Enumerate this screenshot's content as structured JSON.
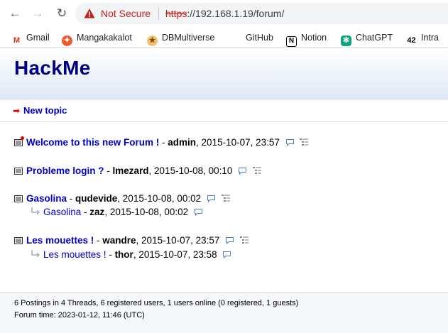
{
  "browser": {
    "not_secure": "Not Secure",
    "url_proto": "https",
    "url_rest": "://192.168.1.19/forum/"
  },
  "bookmarks": [
    {
      "label": "Gmail",
      "icon": "gmail-icon"
    },
    {
      "label": "Mangakakalot",
      "icon": "mangakakalot-icon"
    },
    {
      "label": "DBMultiverse",
      "icon": "dbmultiverse-icon"
    },
    {
      "label": "GitHub",
      "icon": "github-icon"
    },
    {
      "label": "Notion",
      "icon": "notion-icon"
    },
    {
      "label": "ChatGPT",
      "icon": "chatgpt-icon"
    },
    {
      "label": "Intra",
      "icon": "intra-icon"
    }
  ],
  "site": {
    "title": "HackMe",
    "new_topic": "New topic"
  },
  "threads": [
    {
      "subject": "Welcome to this new Forum !",
      "author": "admin",
      "date": ", 2015-10-07, 23:57",
      "is_new": true,
      "replies": []
    },
    {
      "subject": "Probleme login ?",
      "author": "lmezard",
      "date": ", 2015-10-08, 00:10",
      "is_new": false,
      "replies": []
    },
    {
      "subject": "Gasolina",
      "author": "qudevide",
      "date": ", 2015-10-08, 00:02",
      "is_new": false,
      "replies": [
        {
          "subject": "Gasolina",
          "author": "zaz",
          "date": ", 2015-10-08, 00:02"
        }
      ]
    },
    {
      "subject": "Les mouettes !",
      "author": "wandre",
      "date": ", 2015-10-07, 23:57",
      "is_new": false,
      "replies": [
        {
          "subject": "Les mouettes !",
          "author": "thor",
          "date": ", 2015-10-07, 23:58"
        }
      ]
    }
  ],
  "separator": " - ",
  "footer": {
    "stats": "6 Postings in 4 Threads, 6 registered users, 1 users online (0 registered, 1 guests)",
    "time": "Forum time: 2023-01-12, 11:46 (UTC)"
  },
  "colors": {
    "title": "#000080",
    "link": "#0000cc",
    "not_secure": "#c5221f"
  }
}
